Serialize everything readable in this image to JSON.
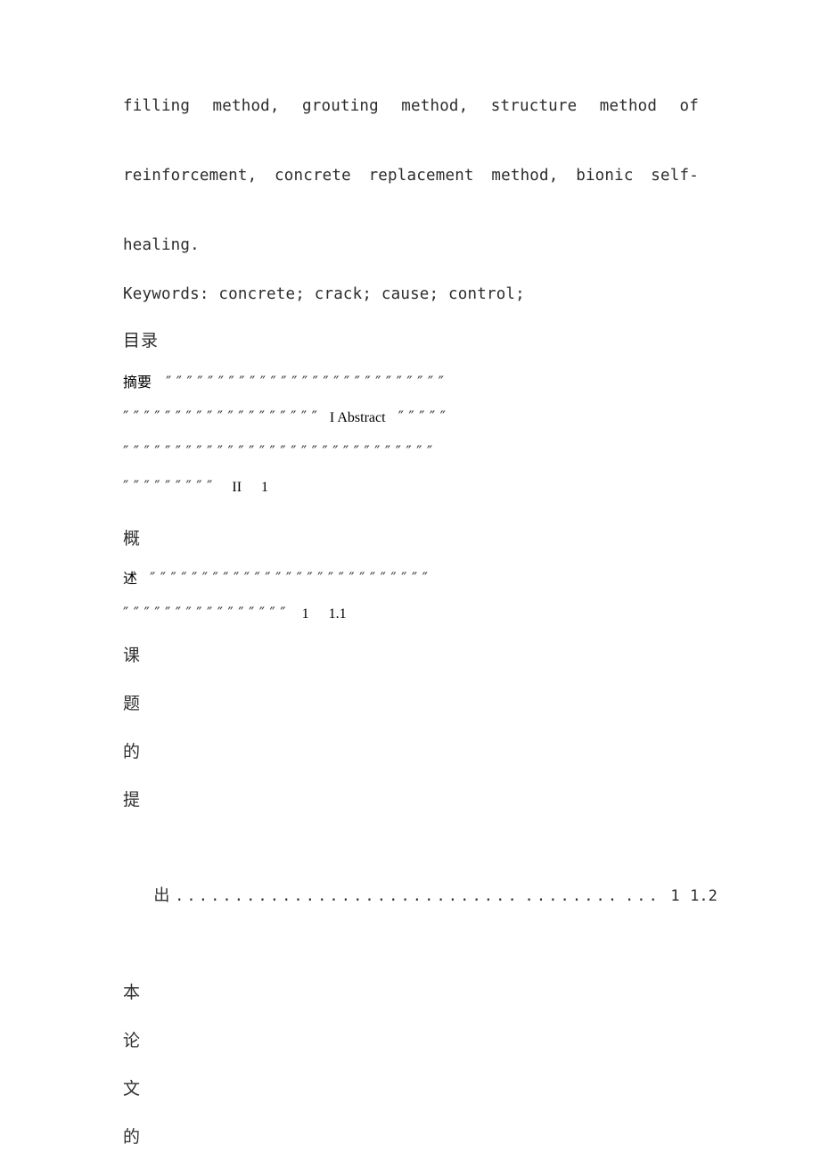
{
  "document": {
    "page_background": "#ffffff",
    "text_color": "#2c2c2c",
    "abstract_tail": {
      "line1": "filling method, grouting method, structure method of",
      "line2": "reinforcement, concrete replacement method, bionic self-",
      "line3": "healing."
    },
    "keywords_line": "Keywords: concrete; crack; cause; control;",
    "toc_heading": "目录",
    "toc_entries": [
      {
        "label": "摘要",
        "leader_line_1": "″ ″ ″ ″ ″ ″ ″ ″ ″ ″ ″ ″ ″ ″ ″ ″ ″ ″ ″ ″ ″ ″ ″ ″ ″ ″ ″",
        "leader_line_2_pre": "″ ″ ″ ″ ″ ″ ″ ″ ″ ″ ″ ″ ″ ″ ″ ″ ″ ″ ″",
        "inline_title": "I Abstract",
        "leader_line_2_post": "″ ″ ″ ″ ″",
        "leader_line_3": "″ ″ ″ ″ ″ ″ ″ ″ ″ ″ ″ ″ ″ ″ ″ ″ ″ ″ ″ ″ ″ ″ ″ ″ ″ ″ ″ ″ ″ ″",
        "leader_line_4": "″ ″ ″ ″ ″ ″ ″ ″ ″",
        "page_number": "II",
        "next_number": "1"
      },
      {
        "label_line_1": "概",
        "label_line_2": "述",
        "leader_line_1": "″ ″ ″ ″ ″ ″ ″ ″ ″ ″ ″ ″ ″ ″ ″ ″ ″ ″ ″ ″ ″ ″ ″ ″ ″ ″ ″",
        "leader_line_2": "″ ″ ″ ″ ″ ″ ″ ″ ″ ″ ″ ″ ″ ″ ″ ″",
        "page_number": "1",
        "section_number": "1.1"
      },
      {
        "chars": [
          "课",
          "题",
          "的",
          "提"
        ],
        "last_char": "出",
        "dots_run_1": ".............................",
        "dots_run_2": "........",
        "dots_run_3": "...",
        "page_number": "1",
        "section_number": "1.2"
      },
      {
        "chars": [
          "本",
          "论",
          "文",
          "的"
        ]
      }
    ]
  }
}
